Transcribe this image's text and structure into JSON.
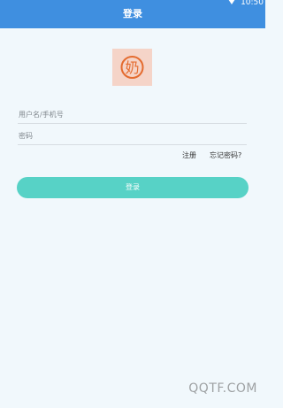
{
  "status_bar": {
    "time": "10:50"
  },
  "app_bar": {
    "title": "登录"
  },
  "logo": {
    "char": "奶",
    "bg_color": "#f5d4c8",
    "ring_color": "#e46b2f"
  },
  "form": {
    "username_placeholder": "用户名/手机号",
    "username_value": "",
    "password_placeholder": "密码",
    "password_value": ""
  },
  "links": {
    "register": "注册",
    "forgot_password": "忘记密码?"
  },
  "login_button": {
    "label": "登录",
    "color": "#57d2c6"
  },
  "colors": {
    "app_bar": "#3f8fe0",
    "background": "#f1f8fc"
  },
  "watermark": "QQTF.COM"
}
